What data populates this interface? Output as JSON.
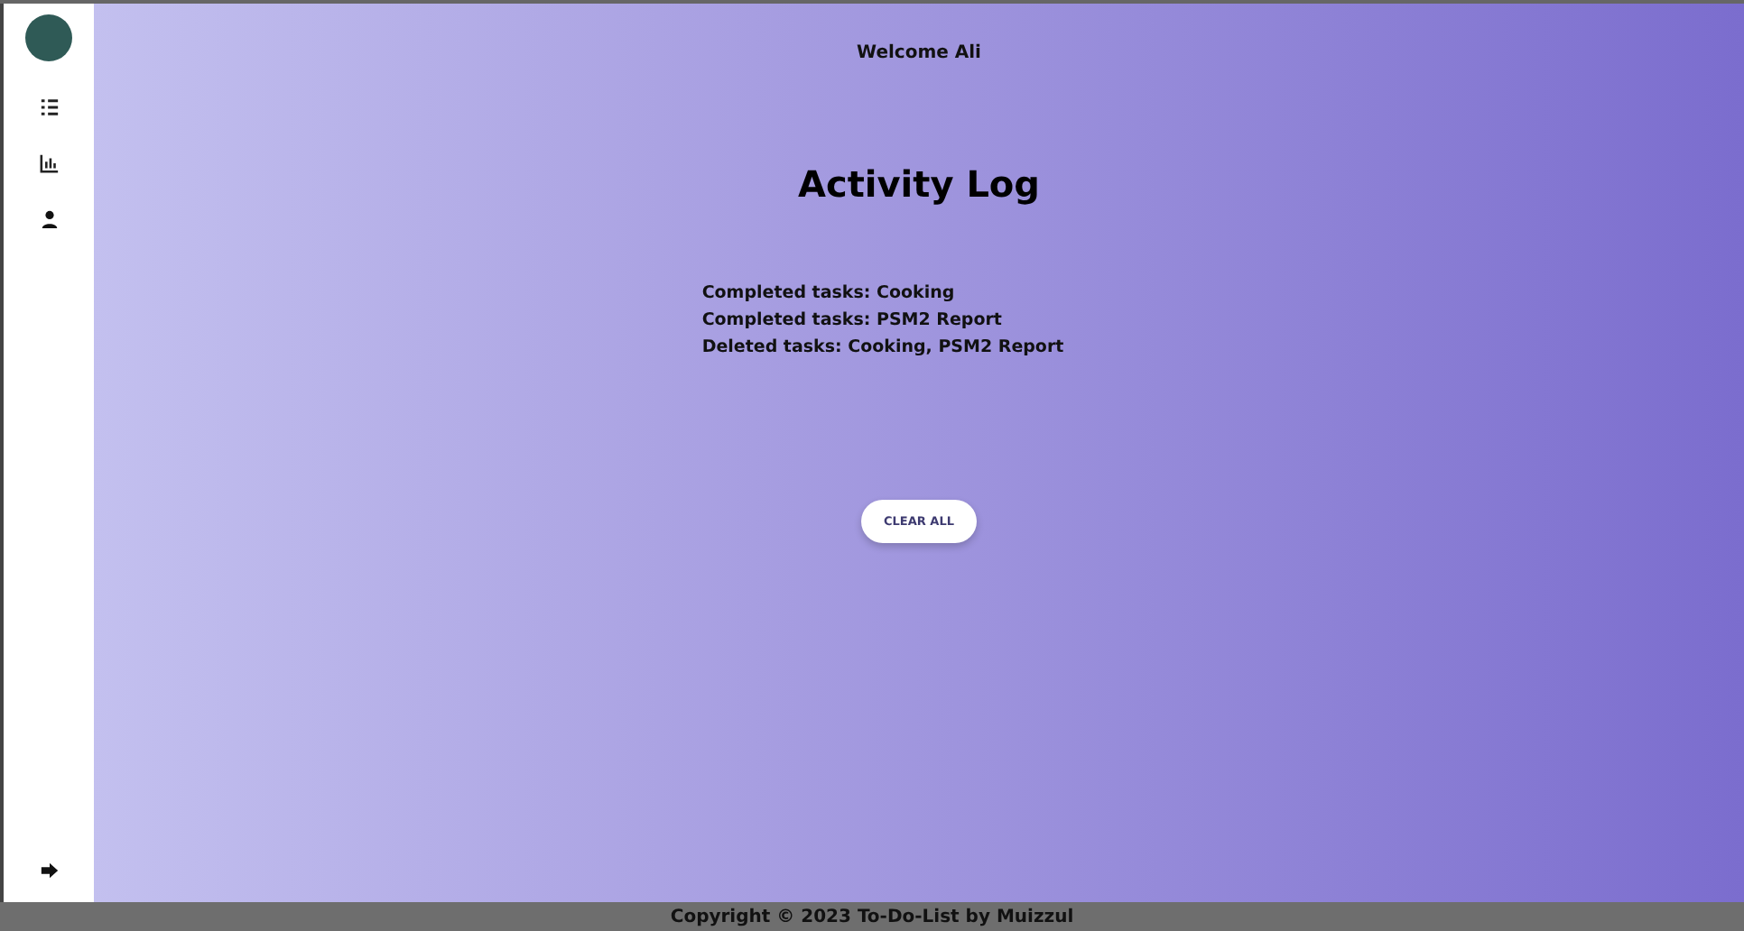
{
  "header": {
    "greeting": "Welcome Ali"
  },
  "page": {
    "title": "Activity Log"
  },
  "log_entries": [
    "Completed tasks: Cooking",
    "Completed tasks: PSM2 Report",
    "Deleted tasks: Cooking, PSM2 Report"
  ],
  "clear_button": {
    "label": "CLEAR ALL"
  },
  "footer": {
    "text": "Copyright © 2023 To-Do-List by Muizzul"
  }
}
